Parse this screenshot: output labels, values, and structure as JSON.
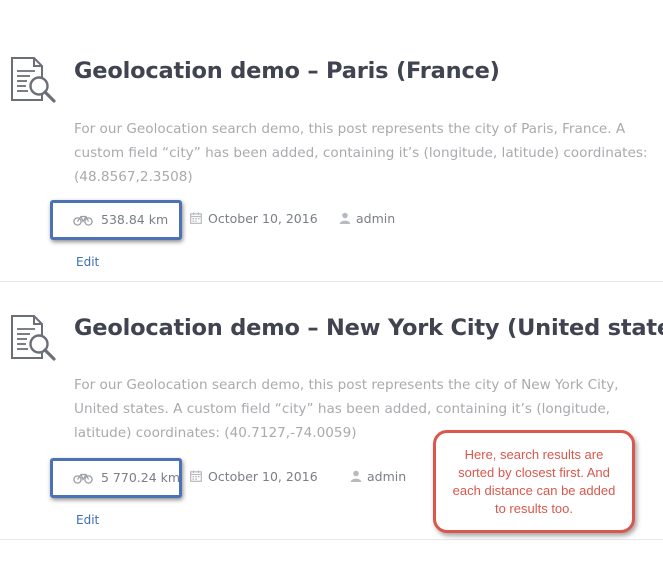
{
  "posts": [
    {
      "icon": "search-document-icon",
      "title": "Geolocation demo – Paris (France)",
      "excerpt": "For our Geolocation search demo, this post represents the city of Paris, France. A custom field “city” has been added, containing it’s (longitude, latitude) coordinates: (48.8567,2.3508)",
      "distance": "538.84 km",
      "date": "October 10, 2016",
      "author": "admin",
      "edit_label": "Edit"
    },
    {
      "icon": "search-document-icon",
      "title": "Geolocation demo – New York City (United states)",
      "excerpt": "For our Geolocation search demo, this post represents the city of New York City, United states. A custom field “city” has been added, containing it’s (longitude, latitude) coordinates: (40.7127,-74.0059)",
      "distance": "5 770.24 km",
      "date": "October 10, 2016",
      "author": "admin",
      "edit_label": "Edit"
    }
  ],
  "callout": {
    "text": "Here, search results are sorted by closest first. And each distance can be added to results too."
  },
  "colors": {
    "highlight_border": "#4a72b4",
    "callout_red": "#d9574b",
    "title": "#3f4450",
    "excerpt": "#a9aaae",
    "link": "#3b6fb0"
  }
}
